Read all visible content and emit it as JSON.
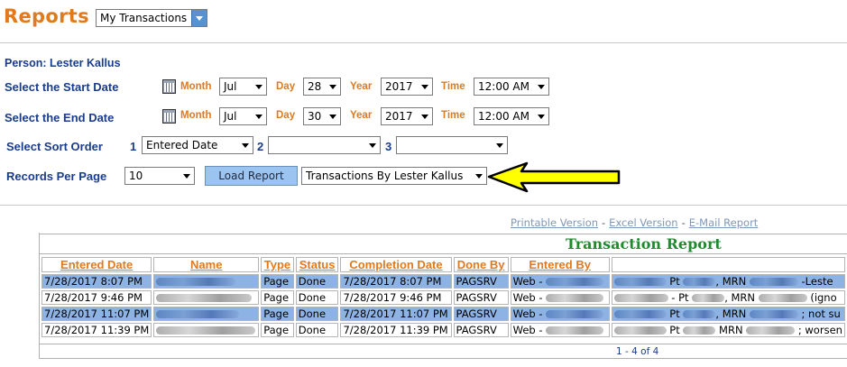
{
  "header": {
    "title": "Reports",
    "report_select": "My Transactions"
  },
  "form": {
    "person_label": "Person: Lester Kallus",
    "start": {
      "label": "Select the Start Date",
      "month_label": "Month",
      "month": "Jul",
      "day_label": "Day",
      "day": "28",
      "year_label": "Year",
      "year": "2017",
      "time_label": "Time",
      "time": "12:00 AM"
    },
    "end": {
      "label": "Select the End Date",
      "month_label": "Month",
      "month": "Jul",
      "day_label": "Day",
      "day": "30",
      "year_label": "Year",
      "year": "2017",
      "time_label": "Time",
      "time": "12:00 AM"
    },
    "sort": {
      "label": "Select Sort Order",
      "n1": "1",
      "v1": "Entered Date",
      "n2": "2",
      "v2": "",
      "n3": "3",
      "v3": ""
    },
    "records": {
      "label": "Records Per Page",
      "value": "10",
      "load_button": "Load Report",
      "report_type": "Transactions By Lester Kallus"
    }
  },
  "links": {
    "printable": "Printable Version",
    "sep": "-",
    "excel": "Excel Version",
    "email": "E-Mail Report"
  },
  "report": {
    "title": "Transaction Report",
    "columns": [
      "Entered Date",
      "Name",
      "Type",
      "Status",
      "Completion Date",
      "Done By",
      "Entered By",
      ""
    ],
    "rows": [
      {
        "entered": "7/28/2017 8:07 PM",
        "type": "Page",
        "status": "Done",
        "completion": "7/28/2017 8:07 PM",
        "done_by": "PAGSRV",
        "entered_by": "Web -",
        "msg_a": "Pt",
        "msg_b": "MRN",
        "msg_c": "-Leste"
      },
      {
        "entered": "7/28/2017 9:46 PM",
        "type": "Page",
        "status": "Done",
        "completion": "7/28/2017 9:46 PM",
        "done_by": "PAGSRV",
        "entered_by": "Web -",
        "msg_a": "- Pt",
        "msg_b": "MRN",
        "msg_c": "(igno"
      },
      {
        "entered": "7/28/2017 11:07 PM",
        "type": "Page",
        "status": "Done",
        "completion": "7/28/2017 11:07 PM",
        "done_by": "PAGSRV",
        "entered_by": "Web -",
        "msg_a": "Pt",
        "msg_b": "MRN",
        "msg_c": "; not su"
      },
      {
        "entered": "7/28/2017 11:39 PM",
        "type": "Page",
        "status": "Done",
        "completion": "7/28/2017 11:39 PM",
        "done_by": "PAGSRV",
        "entered_by": "Web -",
        "msg_a": "Pt",
        "msg_b": "MRN",
        "msg_c": "; worsen"
      }
    ],
    "pager": "1 - 4 of 4"
  },
  "colors": {
    "orange": "#e07a1e",
    "navy": "#1a3c8c",
    "green": "#218a2e",
    "highlight": "#8db2e4",
    "arrow": "#ffff00"
  }
}
